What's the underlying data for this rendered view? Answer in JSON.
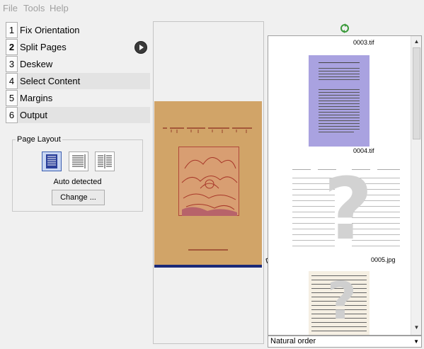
{
  "menu": [
    "File",
    "Tools",
    "Help"
  ],
  "stages": [
    {
      "num": "1",
      "label": "Fix Orientation"
    },
    {
      "num": "2",
      "label": "Split Pages"
    },
    {
      "num": "3",
      "label": "Deskew"
    },
    {
      "num": "4",
      "label": "Select Content"
    },
    {
      "num": "5",
      "label": "Margins"
    },
    {
      "num": "6",
      "label": "Output"
    }
  ],
  "page_layout": {
    "title": "Page Layout",
    "mode_label": "Auto detected",
    "change_label": "Change ..."
  },
  "thumbnails": [
    {
      "caption": "0003.tif"
    },
    {
      "caption": "0004.tif"
    },
    {
      "caption": "0005.jpg"
    }
  ],
  "sort_order": "Natural order",
  "colors": {
    "cover": "#d1a468",
    "selected_thumb": "#a9a2e0",
    "layout_active": "#c8d6f2"
  }
}
